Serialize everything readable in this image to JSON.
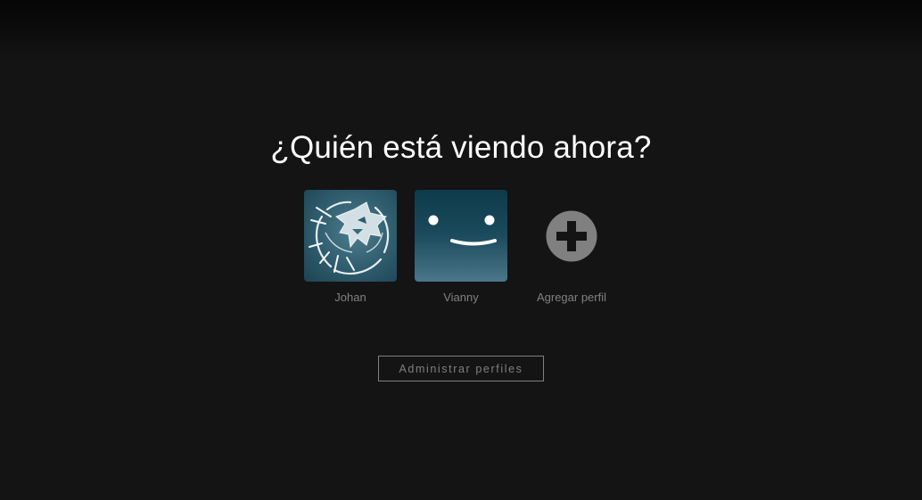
{
  "heading": "¿Quién está viendo ahora?",
  "profiles": [
    {
      "name": "Johan",
      "avatar_icon": "wolf-medallion-icon"
    },
    {
      "name": "Vianny",
      "avatar_icon": "smiley-face-icon"
    }
  ],
  "add_profile": {
    "label": "Agregar perfil",
    "icon": "plus-circle-icon"
  },
  "manage_button": {
    "label": "Administrar perfiles"
  },
  "colors": {
    "background": "#141414",
    "heading": "#ffffff",
    "muted_text": "#808080",
    "wolf_avatar": "#3e6e7f",
    "smile_avatar": "#1b4b5c",
    "add_icon": "#808080"
  }
}
